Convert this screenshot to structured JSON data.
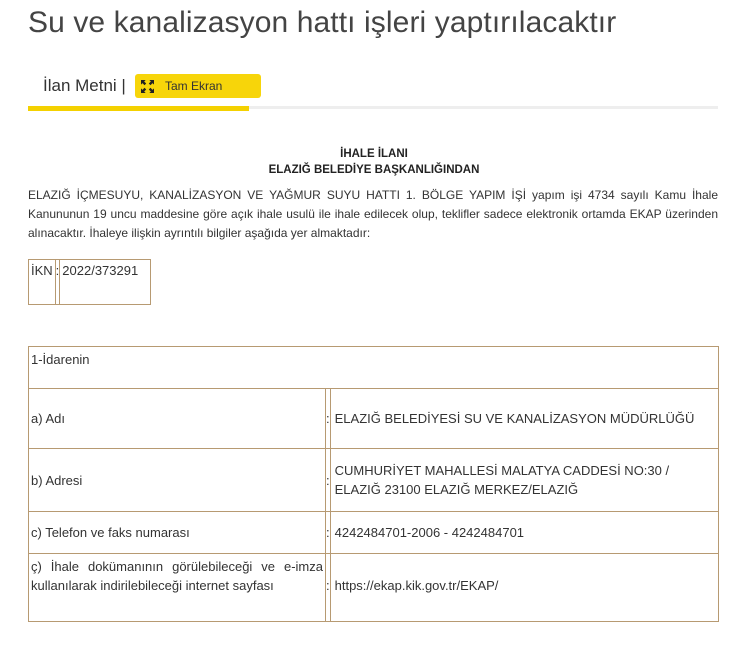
{
  "page": {
    "title": "Su ve kanalizasyon hattı işleri yaptırılacaktır"
  },
  "tabs": {
    "active_label": "İlan Metni |",
    "fullscreen_label": "Tam Ekran"
  },
  "document": {
    "heading1": "İHALE İLANI",
    "heading2": "ELAZIĞ BELEDİYE BAŞKANLIĞINDAN",
    "intro": "ELAZIĞ İÇMESUYU, KANALİZASYON VE YAĞMUR SUYU HATTI 1. BÖLGE YAPIM İŞİ yapım işi 4734 sayılı Kamu İhale Kanununun 19 uncu maddesine göre açık ihale usulü ile ihale edilecek olup, teklifler sadece elektronik ortamda EKAP üzerinden alınacaktır.  İhaleye ilişkin ayrıntılı bilgiler aşağıda yer almaktadır:",
    "ikn": {
      "label": "İKN",
      "separator": ":",
      "value": "2022/373291"
    },
    "section_title": "1-İdarenin",
    "rows": [
      {
        "label": "a) Adı",
        "sep": ":",
        "value": "ELAZIĞ BELEDİYESİ SU VE KANALİZASYON MÜDÜRLÜĞÜ"
      },
      {
        "label": "b) Adresi",
        "sep": ":",
        "value": "CUMHURİYET MAHALLESİ MALATYA CADDESİ NO:30 / ELAZIĞ 23100 ELAZIĞ MERKEZ/ELAZIĞ"
      },
      {
        "label": "c) Telefon ve faks numarası",
        "sep": ":",
        "value": "4242484701-2006 - 4242484701"
      },
      {
        "label": "ç) İhale dokümanının görülebileceği ve e-imza kullanılarak indirilebileceği internet sayfası",
        "sep": ":",
        "value": "https://ekap.kik.gov.tr/EKAP/"
      }
    ]
  },
  "colors": {
    "accent": "#f4d100",
    "border": "#b79a72"
  },
  "icons": {
    "fullscreen": "expand-arrows-icon"
  }
}
